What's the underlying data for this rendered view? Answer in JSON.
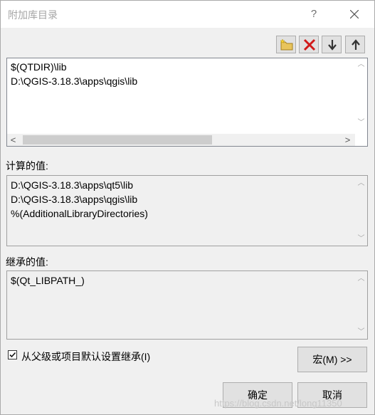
{
  "window": {
    "title": "附加库目录",
    "help_label": "?"
  },
  "editor": {
    "lines": [
      "$(QTDIR)\\lib",
      "D:\\QGIS-3.18.3\\apps\\qgis\\lib"
    ]
  },
  "computed": {
    "label": "计算的值:",
    "lines": [
      "D:\\QGIS-3.18.3\\apps\\qt5\\lib",
      "D:\\QGIS-3.18.3\\apps\\qgis\\lib",
      "%(AdditionalLibraryDirectories)"
    ]
  },
  "inherited": {
    "label": "继承的值:",
    "lines": [
      "$(Qt_LIBPATH_)"
    ]
  },
  "inherit_checkbox": {
    "label": "从父级或项目默认设置继承(I)",
    "checked": true
  },
  "buttons": {
    "macros": "宏(M) >>",
    "ok": "确定",
    "cancel": "取消"
  },
  "watermark": "https://blog.csdn.net/long11350",
  "scroll": {
    "up": "︿",
    "down": "﹀",
    "left": "<",
    "right": ">"
  }
}
